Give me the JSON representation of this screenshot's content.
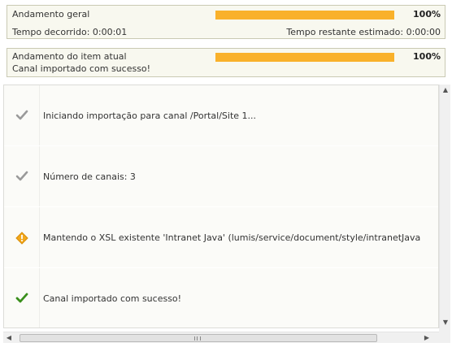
{
  "overall": {
    "label": "Andamento geral",
    "progress_percent": 100,
    "percent_text": "100%",
    "elapsed": "Tempo decorrido: 0:00:01",
    "remaining": "Tempo restante estimado: 0:00:00"
  },
  "current_item": {
    "label": "Andamento do item atual",
    "progress_percent": 100,
    "percent_text": "100%",
    "status": "Canal importado com sucesso!"
  },
  "log": {
    "entries": [
      {
        "icon": "check-gray-icon",
        "text": "Iniciando importação para canal /Portal/Site 1..."
      },
      {
        "icon": "check-gray-icon",
        "text": "Número de canais: 3"
      },
      {
        "icon": "warning-icon",
        "text": "Mantendo o XSL existente 'Intranet Java' (lumis/service/document/style/intranetJava"
      },
      {
        "icon": "check-green-icon",
        "text": "Canal importado com sucesso!"
      }
    ]
  },
  "colors": {
    "progress_fill": "#f9b12b",
    "panel_bg": "#f8f8ef",
    "success_green": "#3a8f1c",
    "warning_orange": "#f2a81d"
  }
}
